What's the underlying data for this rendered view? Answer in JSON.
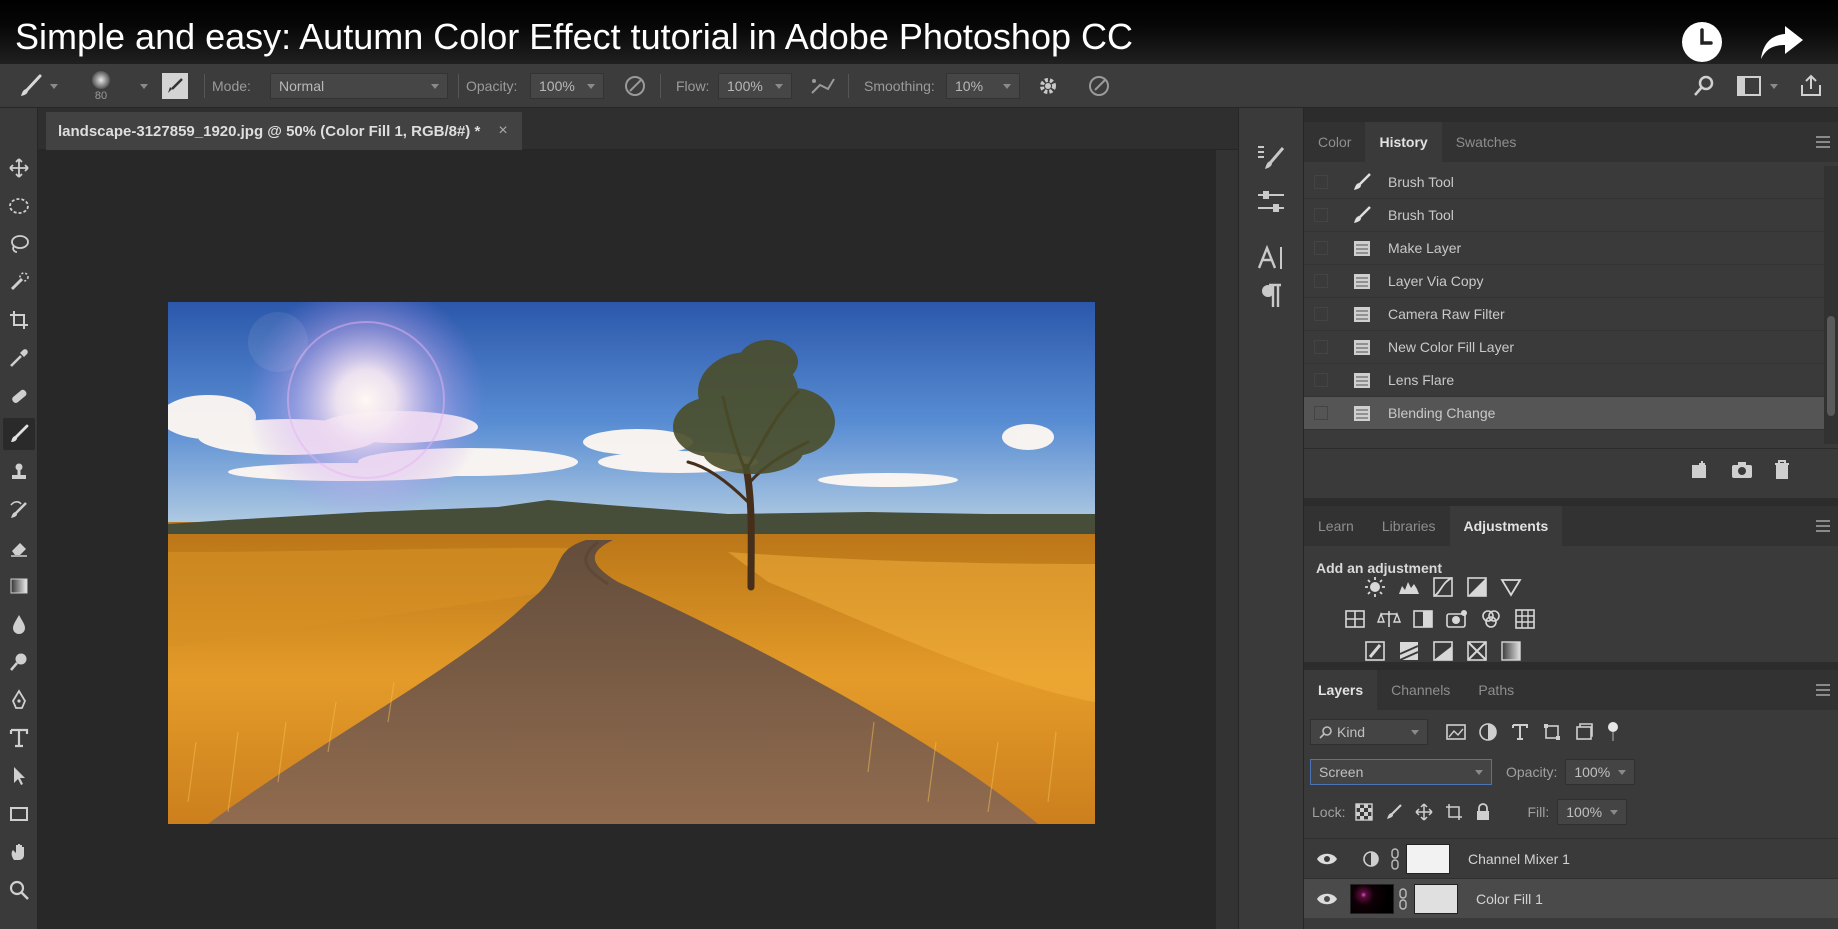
{
  "video": {
    "title": "Simple and easy: Autumn Color Effect tutorial in Adobe Photoshop CC",
    "icons": [
      "clock-icon",
      "share-icon"
    ]
  },
  "options_bar": {
    "brush_size": "80",
    "mode_label": "Mode:",
    "mode_value": "Normal",
    "opacity_label": "Opacity:",
    "opacity_value": "100%",
    "flow_label": "Flow:",
    "flow_value": "100%",
    "smoothing_label": "Smoothing:",
    "smoothing_value": "10%"
  },
  "document": {
    "tab_title": "landscape-3127859_1920.jpg @ 50% (Color Fill 1, RGB/8#) *",
    "close_glyph": "×"
  },
  "history_panel": {
    "tabs": [
      "Color",
      "History",
      "Swatches"
    ],
    "active_tab": "History",
    "items": [
      "Brush Tool",
      "Brush Tool",
      "Make Layer",
      "Layer Via Copy",
      "Camera Raw Filter",
      "New Color Fill Layer",
      "Lens Flare",
      "Blending Change"
    ],
    "current_item": "Blending Change"
  },
  "adjustments_panel": {
    "tabs": [
      "Learn",
      "Libraries",
      "Adjustments"
    ],
    "active_tab": "Adjustments",
    "heading": "Add an adjustment"
  },
  "layers_panel": {
    "tabs": [
      "Layers",
      "Channels",
      "Paths"
    ],
    "active_tab": "Layers",
    "filter_value": "Kind",
    "blend_mode": "Screen",
    "opacity_label": "Opacity:",
    "opacity_value": "100%",
    "lock_label": "Lock:",
    "fill_label": "Fill:",
    "fill_value": "100%",
    "layers": [
      {
        "name": "Channel Mixer 1"
      },
      {
        "name": "Color Fill 1"
      }
    ]
  },
  "colors": {
    "ui_dark": "#2b2b2b",
    "panel": "#3a3a3a",
    "selected_row": "#555555"
  }
}
